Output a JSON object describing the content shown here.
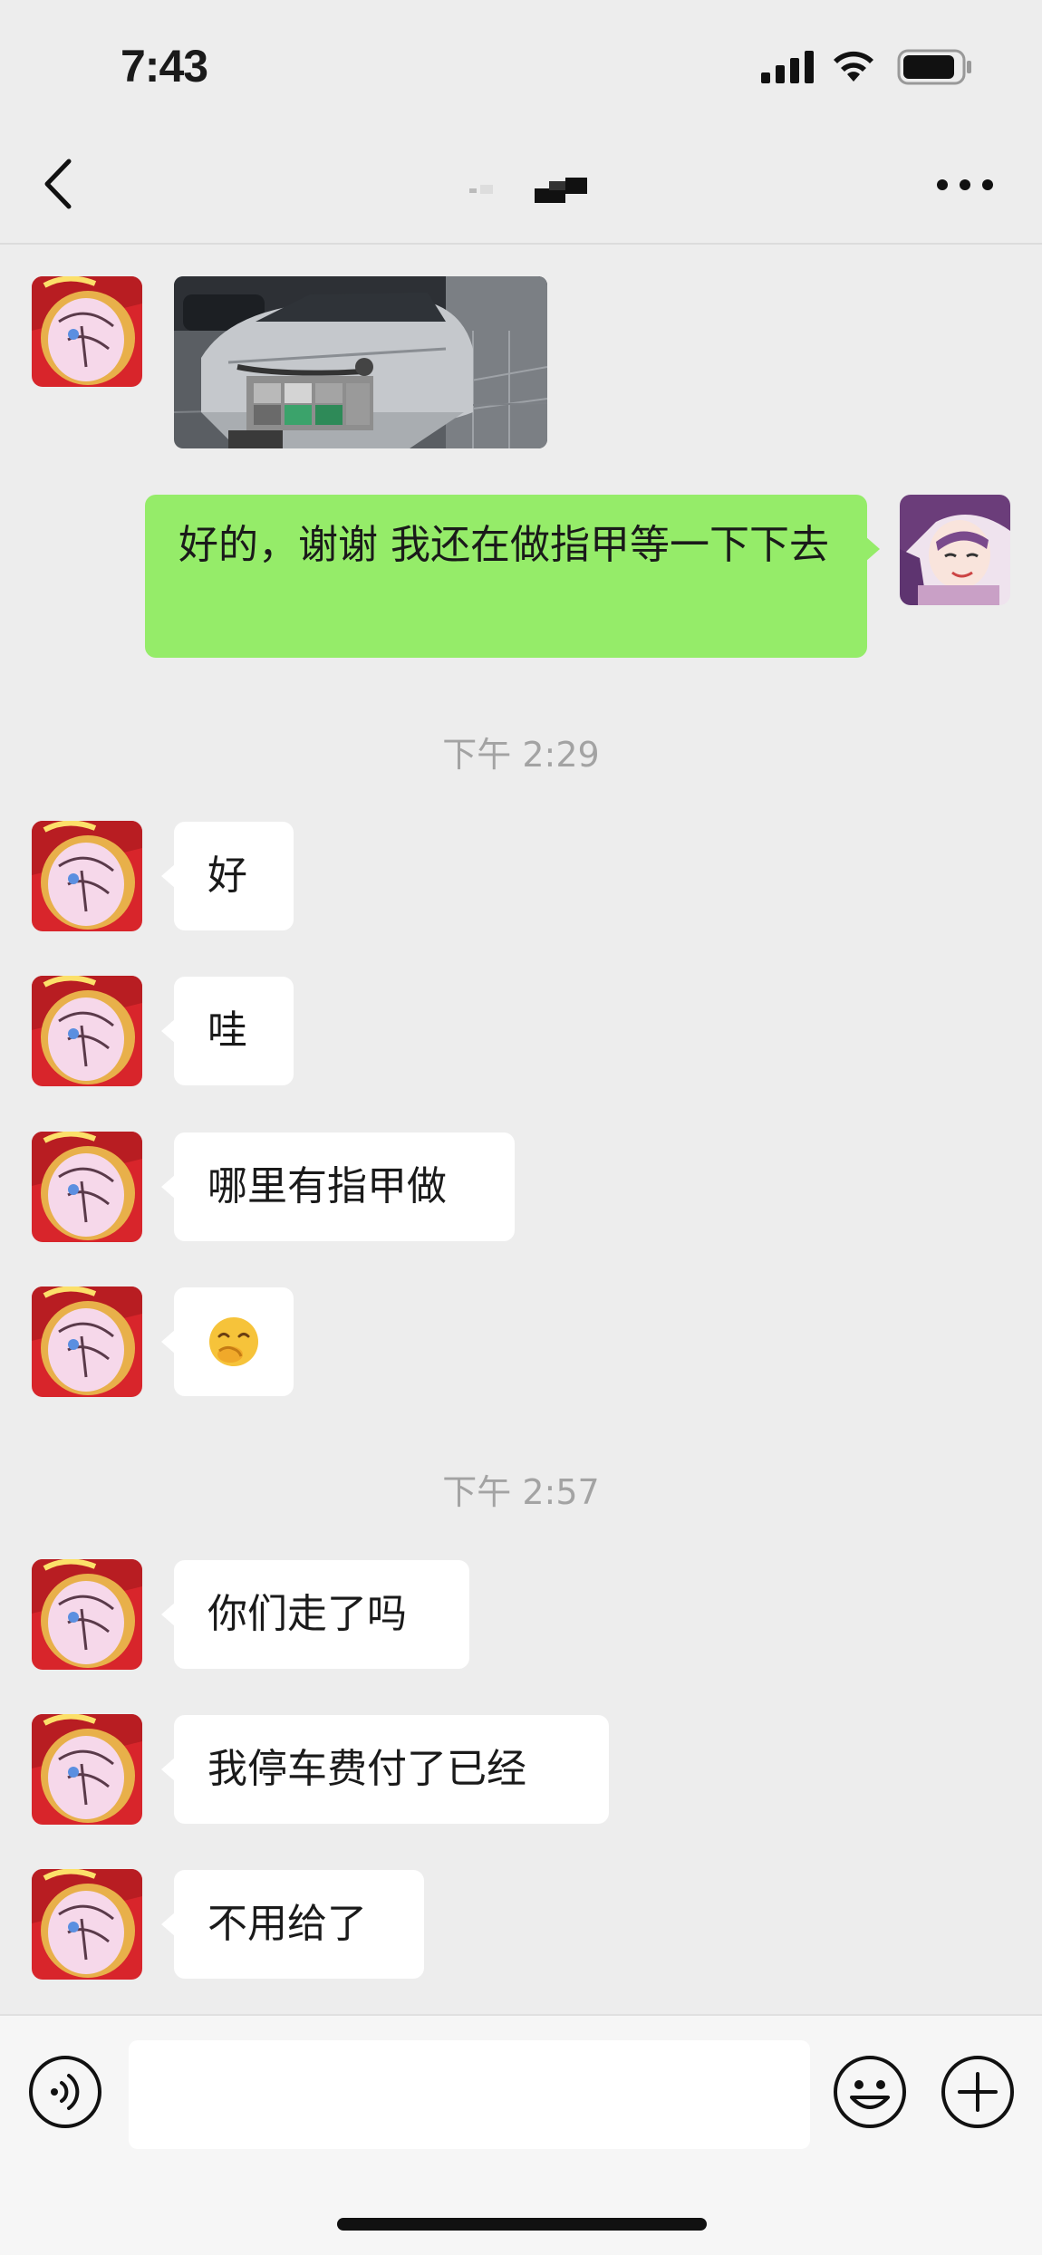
{
  "status_bar": {
    "time": "7:43"
  },
  "nav": {
    "title": ""
  },
  "messages": {
    "m1_photo": "car-photo",
    "m2_out": "好的，谢谢 我还在做指甲等一下下去",
    "ts1": "下午 2:29",
    "m3": "好",
    "m4": "哇",
    "m5": "哪里有指甲做",
    "m6": "🤭",
    "ts2": "下午 2:57",
    "m7": "你们走了吗",
    "m8": "我停车费付了已经",
    "m9": "不用给了"
  },
  "input": {
    "value": "",
    "placeholder": ""
  },
  "colors": {
    "background": "#ededed",
    "incoming_bubble": "#ffffff",
    "outgoing_bubble": "#95ec69",
    "timestamp_text": "#a3a3a3"
  },
  "icons": {
    "back": "chevron-left-icon",
    "more": "more-dots-icon",
    "voice": "voice-icon",
    "emoji": "emoji-icon",
    "plus": "plus-icon"
  }
}
